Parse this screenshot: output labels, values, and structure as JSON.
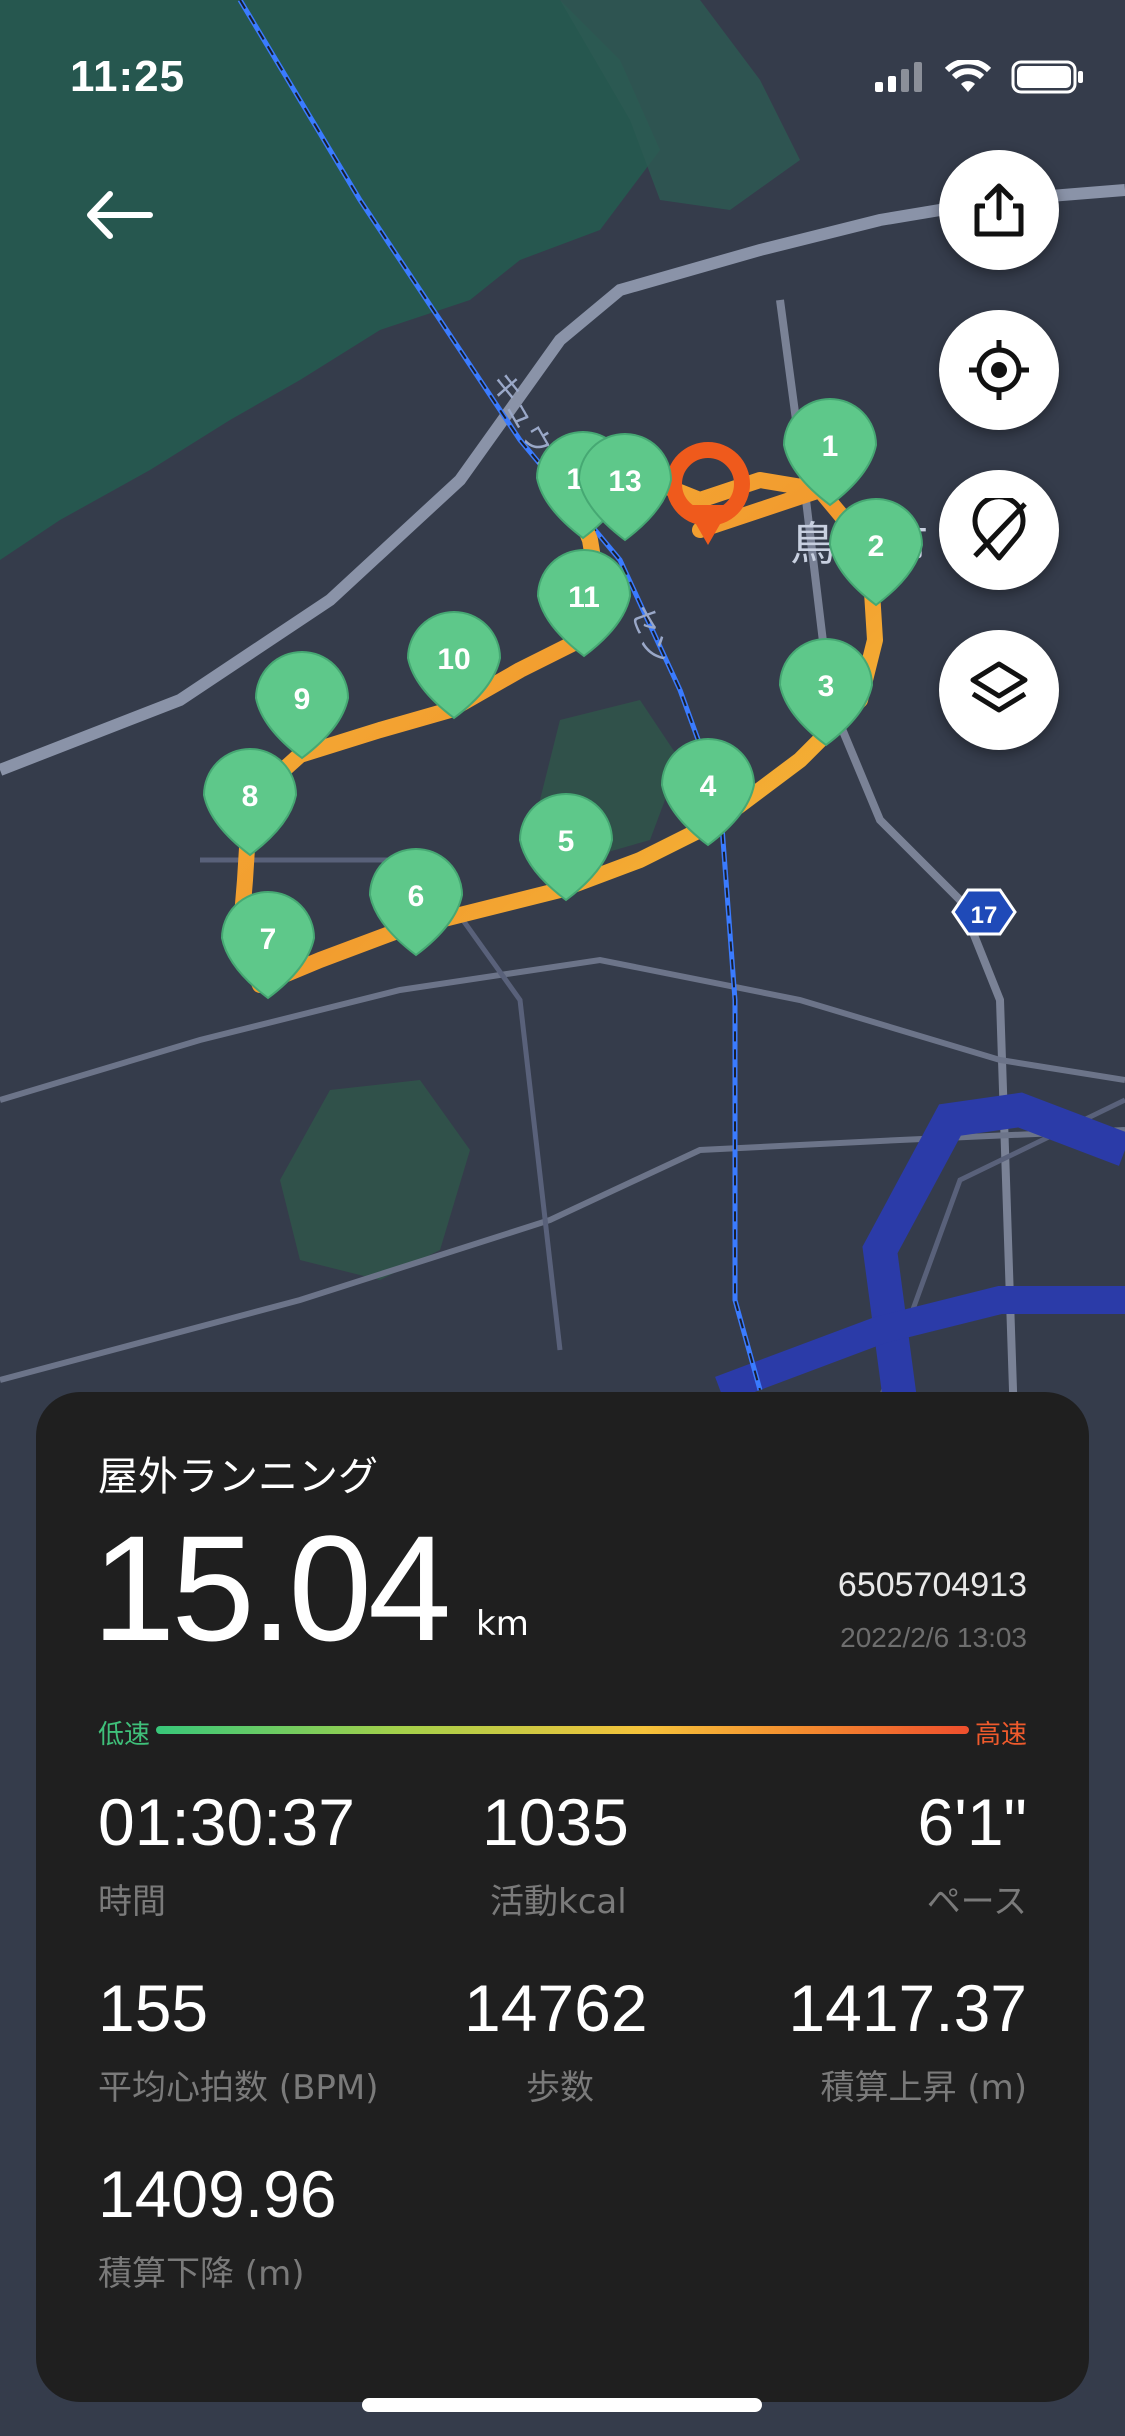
{
  "status_bar": {
    "time": "11:25"
  },
  "map": {
    "labels": {
      "rail_upper": "キュウシ",
      "rail_lower": "セン",
      "city": "鳥栖市",
      "route_shield": "17"
    },
    "markers": [
      "1",
      "2",
      "3",
      "4",
      "5",
      "6",
      "7",
      "8",
      "9",
      "10",
      "11",
      "12",
      "13"
    ]
  },
  "activity": {
    "type": "屋外ランニング",
    "distance": "15.04",
    "distance_unit": "km",
    "id": "6505704913",
    "datetime": "2022/2/6 13:03",
    "speed_low": "低速",
    "speed_high": "高速",
    "stats": {
      "time": {
        "value": "01:30:37",
        "label": "時間"
      },
      "kcal": {
        "value": "1035",
        "label": "活動kcal"
      },
      "pace": {
        "value": "6'1\"",
        "label": "ペース"
      },
      "heart_rate": {
        "value": "155",
        "label": "平均心拍数 (BPM)"
      },
      "steps": {
        "value": "14762",
        "label": "歩数"
      },
      "ascent": {
        "value": "1417.37",
        "label": "積算上昇 (m)"
      },
      "descent": {
        "value": "1409.96",
        "label": "積算下降 (m)"
      }
    }
  },
  "colors": {
    "map_bg": "#353c4b",
    "forest": "#26574f",
    "route_slow": "#f5c23a",
    "route_fast": "#ef4f2d",
    "marker": "#5ec88a",
    "card_bg": "#1f1f1f"
  },
  "icons": [
    "back-arrow-icon",
    "share-icon",
    "locate-icon",
    "hide-icon",
    "layers-icon",
    "signal-icon",
    "wifi-icon",
    "battery-icon",
    "map-pin-icon"
  ]
}
